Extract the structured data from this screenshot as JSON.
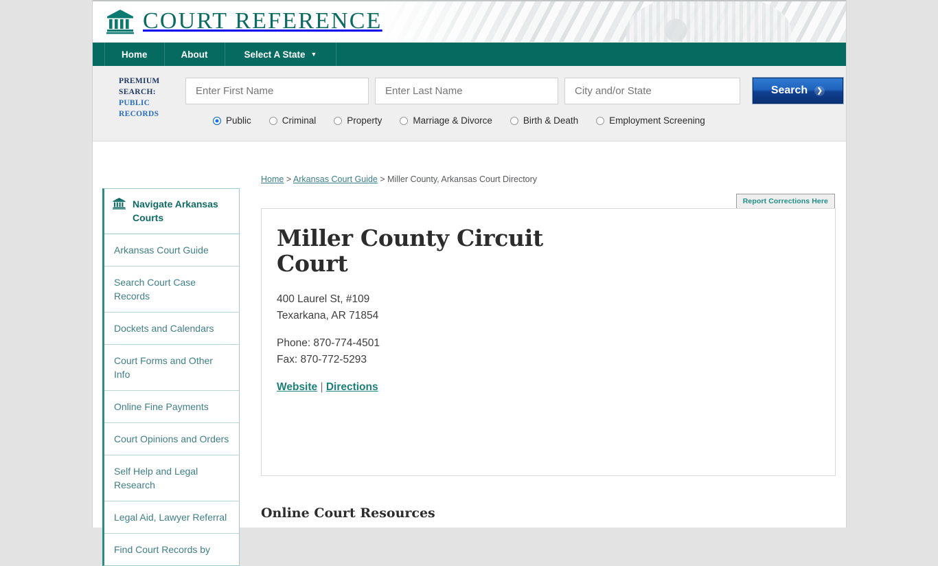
{
  "brand": {
    "title": "COURT REFERENCE",
    "logo_icon": "courthouse-icon"
  },
  "nav": {
    "items": [
      {
        "label": "Home"
      },
      {
        "label": "About"
      },
      {
        "label": "Select A State",
        "caret": "▼"
      }
    ]
  },
  "search": {
    "premium_line1": "PREMIUM",
    "premium_line2": "SEARCH:",
    "premium_line3": "PUBLIC",
    "premium_line4": "RECORDS",
    "first_name_placeholder": "Enter First Name",
    "last_name_placeholder": "Enter Last Name",
    "city_state_placeholder": "City and/or State",
    "first_name_value": "",
    "last_name_value": "",
    "city_state_value": "",
    "button_label": "Search",
    "button_icon": "chevron-right-icon",
    "selected_option": "Public",
    "options": [
      {
        "label": "Public",
        "selected": true
      },
      {
        "label": "Criminal",
        "selected": false
      },
      {
        "label": "Property",
        "selected": false
      },
      {
        "label": "Marriage & Divorce",
        "selected": false
      },
      {
        "label": "Birth & Death",
        "selected": false
      },
      {
        "label": "Employment Screening",
        "selected": false
      }
    ]
  },
  "breadcrumb": {
    "home": "Home",
    "sep1": " > ",
    "guide": "Arkansas Court Guide",
    "sep2": " > ",
    "current": "Miller County, Arkansas Court Directory"
  },
  "report_corrections_label": "Report Corrections Here",
  "sidebar": {
    "heading": "Navigate Arkansas Courts",
    "heading_icon": "courthouse-icon",
    "items": [
      {
        "label": "Arkansas Court Guide"
      },
      {
        "label": "Search Court Case Records"
      },
      {
        "label": "Dockets and Calendars"
      },
      {
        "label": "Court Forms and Other Info"
      },
      {
        "label": "Online Fine Payments"
      },
      {
        "label": "Court Opinions and Orders"
      },
      {
        "label": "Self Help and Legal Research"
      },
      {
        "label": "Legal Aid, Lawyer Referral"
      },
      {
        "label": "Find Court Records by"
      }
    ]
  },
  "court": {
    "title": "Miller County Circuit Court",
    "address_line1": "400 Laurel St, #109",
    "address_line2": "Texarkana, AR 71854",
    "phone": "Phone: 870-774-4501",
    "fax": "Fax: 870-772-5293",
    "website_label": "Website",
    "link_separator": "|",
    "directions_label": "Directions"
  },
  "resources_heading": "Online Court Resources",
  "colors": {
    "teal": "#056b61",
    "link_teal": "#3f7f86",
    "brand_teal": "#0b6a62",
    "search_blue": "#1f63bd",
    "premium_navy": "#1f3864",
    "premium_blue": "#2a6ebb",
    "page_bg": "#e3e3e3"
  }
}
